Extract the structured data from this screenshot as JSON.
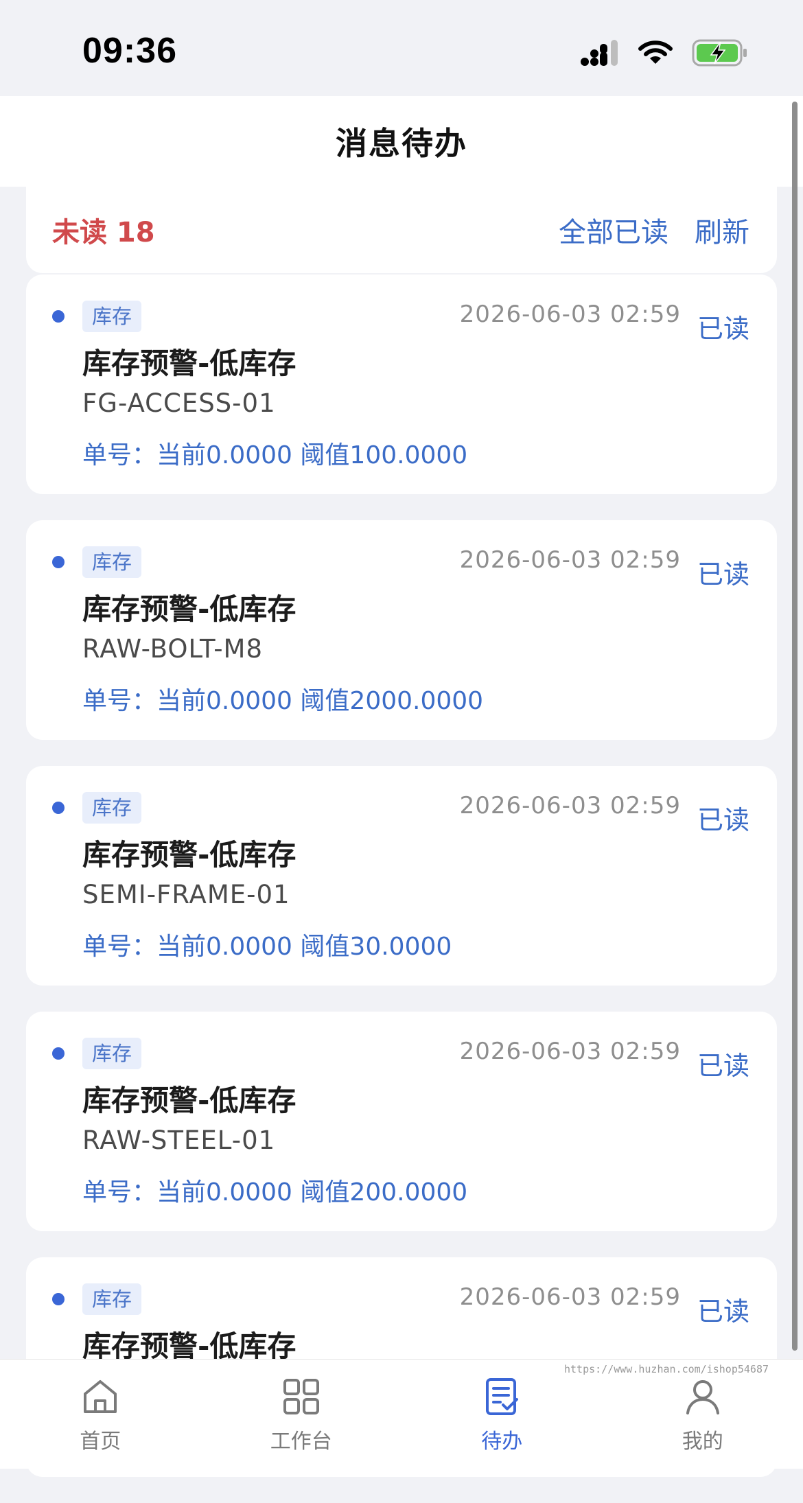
{
  "status_bar": {
    "time": "09:36"
  },
  "header": {
    "title": "消息待办"
  },
  "summary": {
    "unread_label": "未读 18",
    "mark_all_read": "全部已读",
    "refresh": "刷新"
  },
  "messages": [
    {
      "tag": "库存",
      "time": "2026-06-03 02:59",
      "read_action": "已读",
      "title": "库存预警-低库存",
      "code": "FG-ACCESS-01",
      "detail": "单号：当前0.0000 阈值100.0000"
    },
    {
      "tag": "库存",
      "time": "2026-06-03 02:59",
      "read_action": "已读",
      "title": "库存预警-低库存",
      "code": "RAW-BOLT-M8",
      "detail": "单号：当前0.0000 阈值2000.0000"
    },
    {
      "tag": "库存",
      "time": "2026-06-03 02:59",
      "read_action": "已读",
      "title": "库存预警-低库存",
      "code": "SEMI-FRAME-01",
      "detail": "单号：当前0.0000 阈值30.0000"
    },
    {
      "tag": "库存",
      "time": "2026-06-03 02:59",
      "read_action": "已读",
      "title": "库存预警-低库存",
      "code": "RAW-STEEL-01",
      "detail": "单号：当前0.0000 阈值200.0000"
    },
    {
      "tag": "库存",
      "time": "2026-06-03 02:59",
      "read_action": "已读",
      "title": "库存预警-低库存",
      "code": "",
      "detail": ""
    }
  ],
  "tabbar": {
    "items": [
      {
        "label": "首页",
        "icon": "home-icon"
      },
      {
        "label": "工作台",
        "icon": "grid-icon"
      },
      {
        "label": "待办",
        "icon": "todo-list-icon"
      },
      {
        "label": "我的",
        "icon": "user-icon"
      }
    ],
    "active_index": 2
  },
  "watermark": "https://www.huzhan.com/ishop54687",
  "colors": {
    "accent": "#3a66d6",
    "unread": "#d0494b",
    "link": "#3b6cc7"
  }
}
